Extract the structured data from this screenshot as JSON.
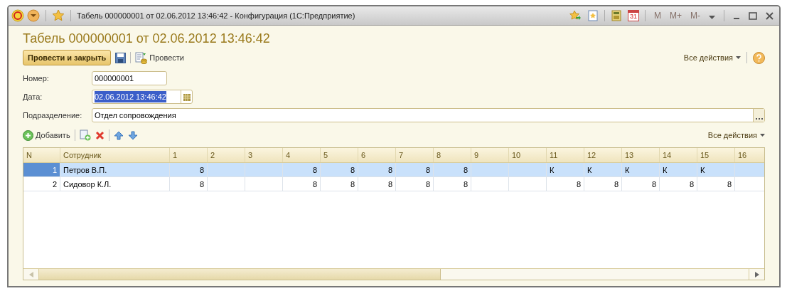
{
  "window": {
    "title": "Табель 000000001 от 02.06.2012 13:46:42 - Конфигурация  (1С:Предприятие)",
    "calendar_day": "31",
    "memory_buttons": [
      {
        "label": "M",
        "disabled": true
      },
      {
        "label": "M+",
        "disabled": true
      },
      {
        "label": "M-",
        "disabled": true
      }
    ]
  },
  "heading": "Табель 000000001 от 02.06.2012 13:46:42",
  "toolbar": {
    "primary_button": "Провести и закрыть",
    "post_button": "Провести",
    "all_actions": "Все действия"
  },
  "fields": [
    {
      "label": "Номер:",
      "value": "000000001",
      "kind": "short",
      "selected": false
    },
    {
      "label": "Дата:",
      "value": "02.06.2012 13:46:42",
      "kind": "date",
      "selected": true
    },
    {
      "label": "Подразделение:",
      "value": "Отдел сопровождения",
      "kind": "wide",
      "selected": false
    }
  ],
  "table_toolbar": {
    "add_button": "Добавить",
    "all_actions": "Все действия"
  },
  "table": {
    "columns": [
      "N",
      "Сотрудник",
      "1",
      "2",
      "3",
      "4",
      "5",
      "6",
      "7",
      "8",
      "9",
      "10",
      "11",
      "12",
      "13",
      "14",
      "15",
      "16"
    ],
    "rows": [
      {
        "selected": true,
        "cells": [
          {
            "text": "1",
            "kind": "number"
          },
          {
            "text": "Петров В.П.",
            "kind": "name"
          },
          {
            "text": "8",
            "kind": "hours"
          },
          "",
          "",
          {
            "text": "8",
            "kind": "hours"
          },
          {
            "text": "8",
            "kind": "hours"
          },
          {
            "text": "8",
            "kind": "hours"
          },
          {
            "text": "8",
            "kind": "hours"
          },
          {
            "text": "8",
            "kind": "hours"
          },
          "",
          "",
          {
            "text": "К",
            "kind": "code"
          },
          {
            "text": "К",
            "kind": "code"
          },
          {
            "text": "К",
            "kind": "code"
          },
          {
            "text": "К",
            "kind": "code"
          },
          {
            "text": "К",
            "kind": "code"
          },
          ""
        ]
      },
      {
        "selected": false,
        "cells": [
          {
            "text": "2",
            "kind": "number"
          },
          {
            "text": "Сидовор К.Л.",
            "kind": "name"
          },
          {
            "text": "8",
            "kind": "hours"
          },
          "",
          "",
          {
            "text": "8",
            "kind": "hours"
          },
          {
            "text": "8",
            "kind": "hours"
          },
          {
            "text": "8",
            "kind": "hours"
          },
          {
            "text": "8",
            "kind": "hours"
          },
          {
            "text": "8",
            "kind": "hours"
          },
          "",
          "",
          {
            "text": "8",
            "kind": "hours"
          },
          {
            "text": "8",
            "kind": "hours"
          },
          {
            "text": "8",
            "kind": "hours"
          },
          {
            "text": "8",
            "kind": "hours"
          },
          {
            "text": "8",
            "kind": "hours"
          },
          ""
        ]
      }
    ]
  }
}
